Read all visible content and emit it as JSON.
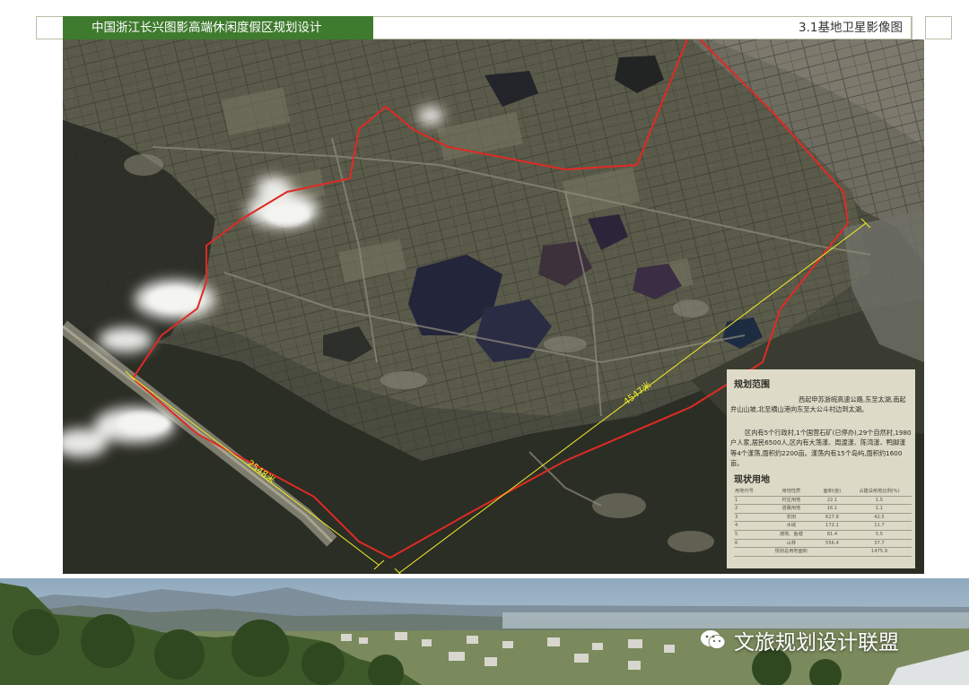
{
  "header": {
    "project_title": "中国浙江长兴图影高端休闲度假区规划设计",
    "section_label": "3.1基地卫星影像图"
  },
  "map": {
    "dimension_long": "4547米",
    "dimension_short": "2548米",
    "colors": {
      "boundary": "#e02a24",
      "dimension_line": "#f2ef26"
    }
  },
  "panel": {
    "scope_heading": "规划范围",
    "scope_text": "西起申苏浙皖高速公路,东至太湖,南起弁山山坡,北至横山港向东至大公斗村边到太湖。",
    "villages_text": "区内有5个行政村,1个国营石矿(已停办),29个自然村,1980户人家,居民6500人,区内有大荡漾、周渡漾、陈湾漾、鸭脚漾等4个漾荡,面积约2200亩。漾荡内有15个岛屿,面积约1600亩。",
    "landuse_heading": "现状用地",
    "landuse_rows": [
      [
        "用地代号",
        "用地性质",
        "面积(亩)",
        "占建设用地比例(%)"
      ],
      [
        "1",
        "村庄用地",
        "22.1",
        "1.5"
      ],
      [
        "2",
        "道路用地",
        "16.1",
        "1.1"
      ],
      [
        "3",
        "农田",
        "627.8",
        "42.5"
      ],
      [
        "4",
        "水域",
        "172.1",
        "11.7"
      ],
      [
        "5",
        "滩地、鱼塘",
        "81.4",
        "5.5"
      ],
      [
        "6",
        "山林",
        "556.4",
        "37.7"
      ],
      [
        "",
        "规划总用地面积",
        "",
        "1475.9"
      ]
    ]
  },
  "watermark": {
    "icon": "wechat-icon",
    "text": "文旅规划设计联盟"
  }
}
